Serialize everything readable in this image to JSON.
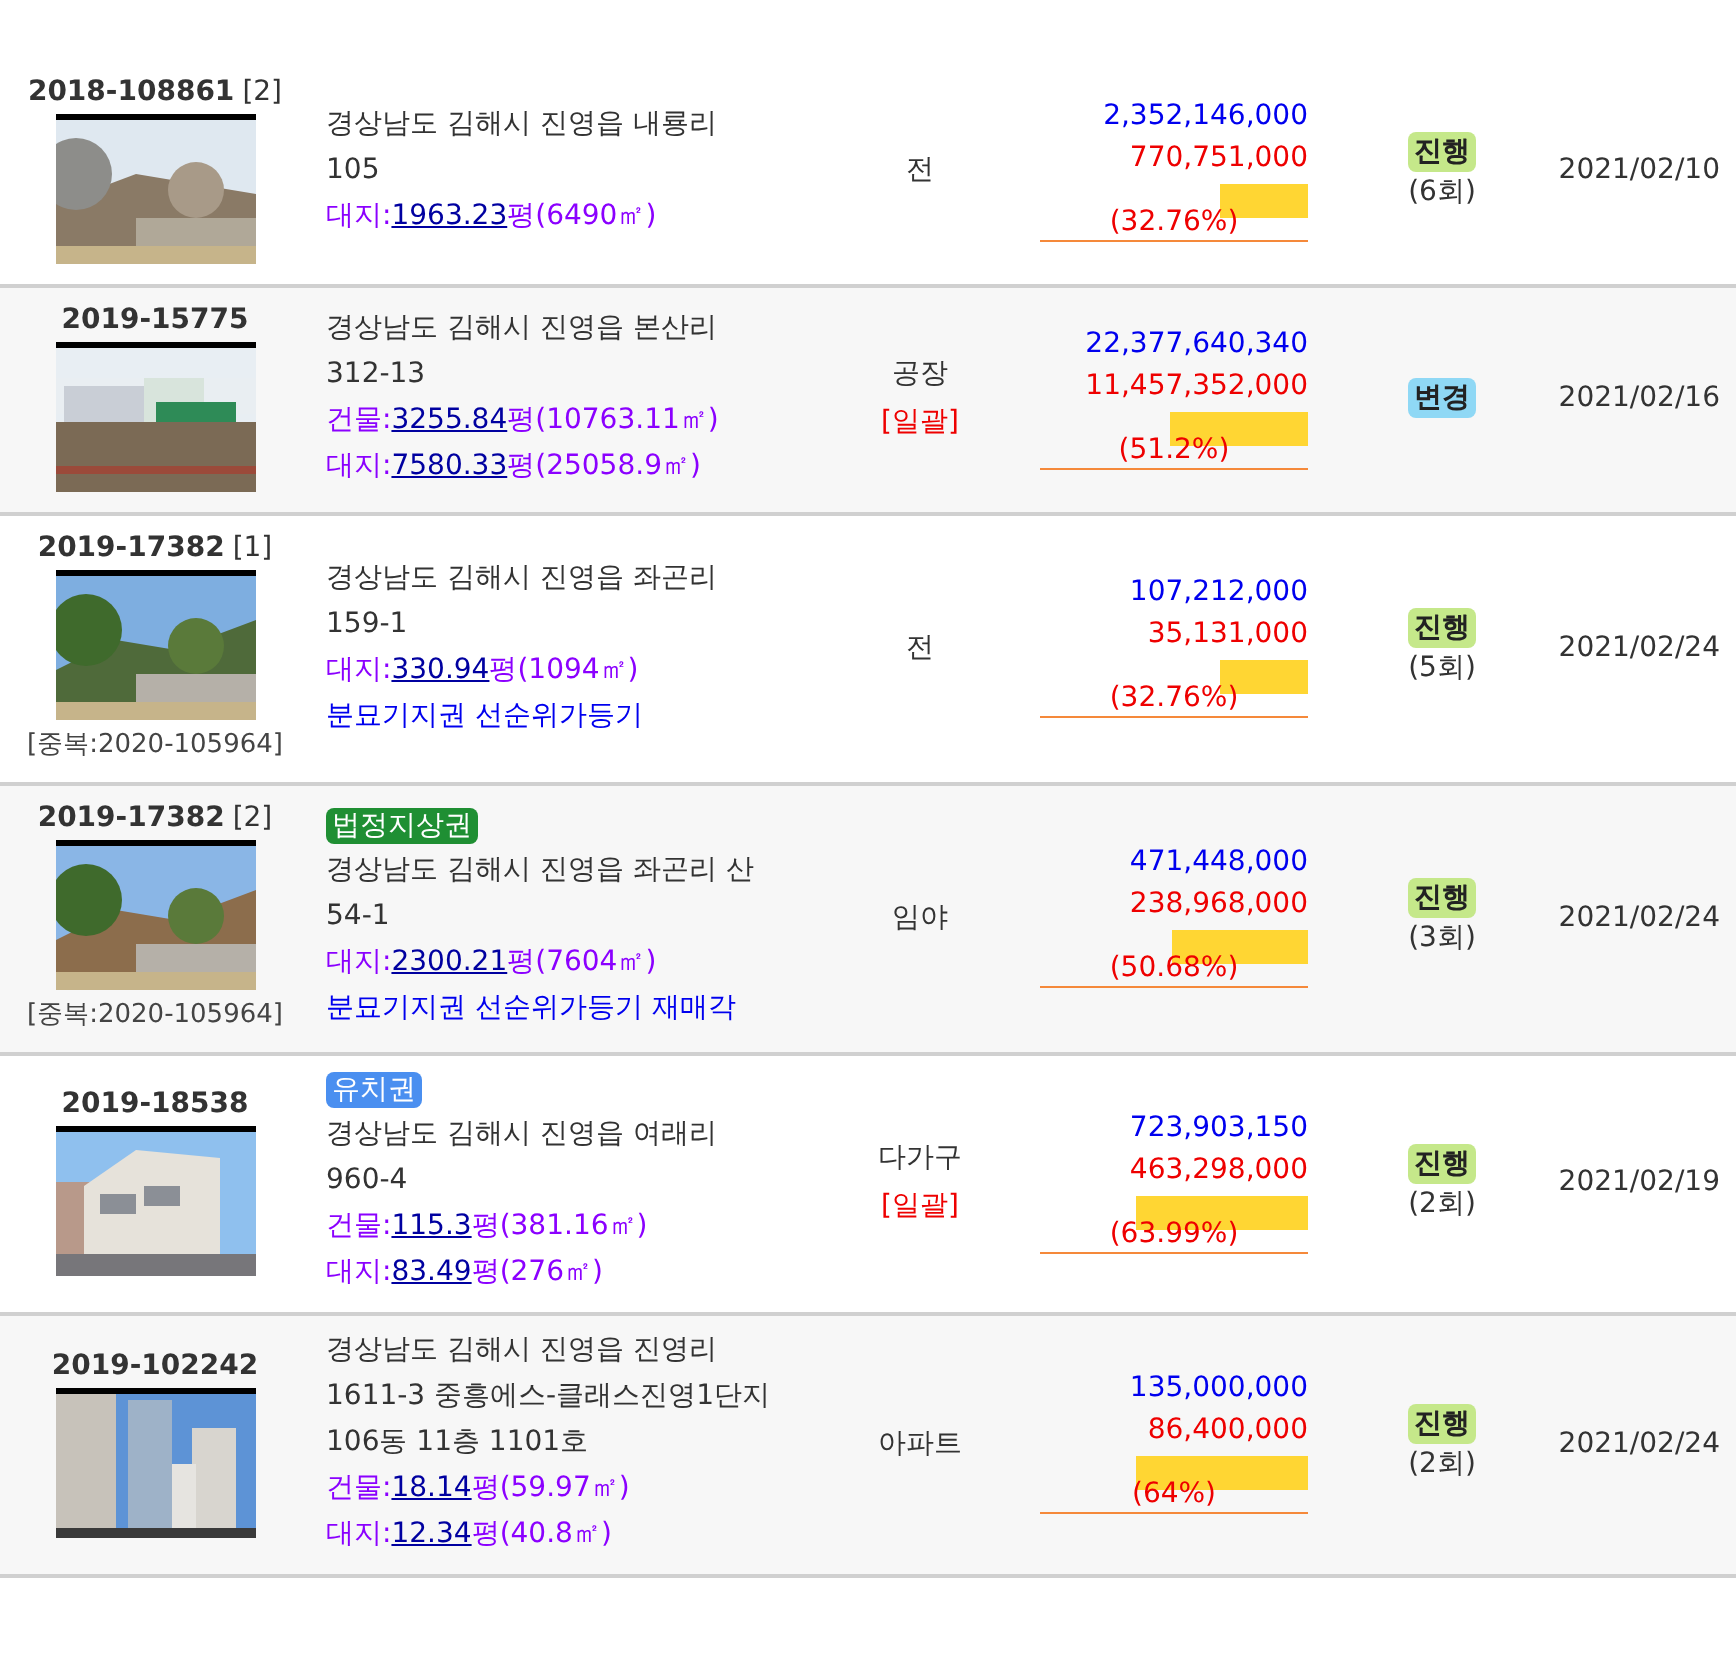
{
  "listings": [
    {
      "case_no": "2018-108861",
      "item_no": "[2]",
      "address": [
        "경상남도 김해시 진영읍 내룡리",
        "105"
      ],
      "areas": [
        {
          "label": "대지:",
          "pyeong": "1963.23",
          "unit": "평(6490㎡)"
        }
      ],
      "use": "전",
      "appraisal": "2,352,146,000",
      "minimum": "770,751,000",
      "level": 0.3276,
      "percent": "(32.76%)",
      "status": {
        "label": "진행",
        "color": "#c5e88a",
        "rounds": "(6회)"
      },
      "date": "2021/02/10"
    },
    {
      "case_no": "2019-15775",
      "address": [
        "경상남도 김해시 진영읍 본산리",
        "312-13"
      ],
      "areas": [
        {
          "label": "건물:",
          "pyeong": "3255.84",
          "unit": "평(10763.11㎡)"
        },
        {
          "label": "대지:",
          "pyeong": "7580.33",
          "unit": "평(25058.9㎡)"
        }
      ],
      "use": "공장",
      "batch": "[일괄]",
      "appraisal": "22,377,640,340",
      "minimum": "11,457,352,000",
      "level": 0.512,
      "percent": "(51.2%)",
      "status": {
        "label": "변경",
        "color": "#8fd8f5"
      },
      "date": "2021/02/16"
    },
    {
      "case_no": "2019-17382",
      "item_no": "[1]",
      "duplicate": "[중복:2020-105964]",
      "address": [
        "경상남도 김해시 진영읍 좌곤리",
        "159-1"
      ],
      "areas": [
        {
          "label": "대지:",
          "pyeong": "330.94",
          "unit": "평(1094㎡)"
        }
      ],
      "notes": [
        "분묘기지권 선순위가등기"
      ],
      "use": "전",
      "appraisal": "107,212,000",
      "minimum": "35,131,000",
      "level": 0.3276,
      "percent": "(32.76%)",
      "status": {
        "label": "진행",
        "color": "#c5e88a",
        "rounds": "(5회)"
      },
      "date": "2021/02/24"
    },
    {
      "case_no": "2019-17382",
      "item_no": "[2]",
      "duplicate": "[중복:2020-105964]",
      "tag": {
        "label": "법정지상권",
        "color": "#1f8f33"
      },
      "address": [
        "경상남도 김해시 진영읍 좌곤리 산",
        "54-1"
      ],
      "areas": [
        {
          "label": "대지:",
          "pyeong": "2300.21",
          "unit": "평(7604㎡)"
        }
      ],
      "notes": [
        "분묘기지권 선순위가등기 재매각"
      ],
      "use": "임야",
      "appraisal": "471,448,000",
      "minimum": "238,968,000",
      "level": 0.5068,
      "percent": "(50.68%)",
      "status": {
        "label": "진행",
        "color": "#c5e88a",
        "rounds": "(3회)"
      },
      "date": "2021/02/24"
    },
    {
      "case_no": "2019-18538",
      "tag": {
        "label": "유치권",
        "color": "#4a8ff0"
      },
      "address": [
        "경상남도 김해시 진영읍 여래리",
        "960-4"
      ],
      "areas": [
        {
          "label": "건물:",
          "pyeong": "115.3",
          "unit": "평(381.16㎡)"
        },
        {
          "label": "대지:",
          "pyeong": "83.49",
          "unit": "평(276㎡)"
        }
      ],
      "use": "다가구",
      "batch": "[일괄]",
      "appraisal": "723,903,150",
      "minimum": "463,298,000",
      "level": 0.6399,
      "percent": "(63.99%)",
      "status": {
        "label": "진행",
        "color": "#c5e88a",
        "rounds": "(2회)"
      },
      "date": "2021/02/19"
    },
    {
      "case_no": "2019-102242",
      "address": [
        "경상남도 김해시 진영읍 진영리",
        "1611-3 중흥에스-클래스진영1단지",
        "106동 11층 1101호"
      ],
      "areas": [
        {
          "label": "건물:",
          "pyeong": "18.14",
          "unit": "평(59.97㎡)"
        },
        {
          "label": "대지:",
          "pyeong": "12.34",
          "unit": "평(40.8㎡)"
        }
      ],
      "use": "아파트",
      "appraisal": "135,000,000",
      "minimum": "86,400,000",
      "level": 0.64,
      "percent": "(64%)",
      "status": {
        "label": "진행",
        "color": "#c5e88a",
        "rounds": "(2회)"
      },
      "date": "2021/02/24"
    }
  ]
}
